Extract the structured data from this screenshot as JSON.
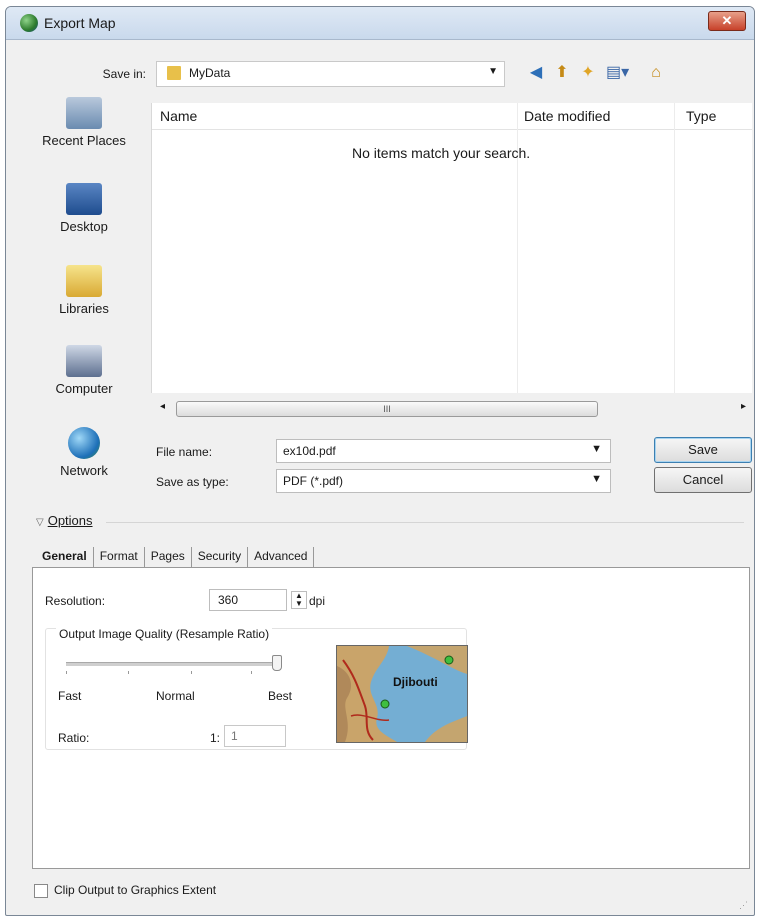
{
  "window": {
    "title": "Export Map",
    "close_label": "✕"
  },
  "toolbar": {
    "save_in_label": "Save in:",
    "save_in_value": "MyData",
    "icons": [
      "back-icon",
      "up-folder-icon",
      "new-folder-icon",
      "views-menu-icon",
      "home-icon"
    ]
  },
  "places": [
    {
      "label": "Recent Places",
      "icon": "recent-places-icon"
    },
    {
      "label": "Desktop",
      "icon": "desktop-icon"
    },
    {
      "label": "Libraries",
      "icon": "libraries-icon"
    },
    {
      "label": "Computer",
      "icon": "computer-icon"
    },
    {
      "label": "Network",
      "icon": "network-icon"
    }
  ],
  "file_list": {
    "columns": [
      "Name",
      "Date modified",
      "Type"
    ],
    "empty_message": "No items match your search.",
    "scroll_thumb": "III"
  },
  "file_name": {
    "label": "File name:",
    "value": "ex10d.pdf"
  },
  "save_as_type": {
    "label": "Save as type:",
    "value": "PDF (*.pdf)"
  },
  "buttons": {
    "save": "Save",
    "cancel": "Cancel"
  },
  "options": {
    "toggle_label": "Options",
    "tabs": [
      {
        "label": "General",
        "active": true
      },
      {
        "label": "Format",
        "active": false
      },
      {
        "label": "Pages",
        "active": false
      },
      {
        "label": "Security",
        "active": false
      },
      {
        "label": "Advanced",
        "active": false
      }
    ],
    "resolution": {
      "label": "Resolution:",
      "value": "360",
      "unit": "dpi"
    },
    "quality": {
      "title": "Output Image Quality (Resample Ratio)",
      "labels": {
        "fast": "Fast",
        "normal": "Normal",
        "best": "Best"
      },
      "slider_position": "Best",
      "ratio_label": "Ratio:",
      "ratio_fixed": "1:",
      "ratio_value": "1"
    },
    "preview_label": "Djibouti"
  },
  "clip_output": {
    "label": "Clip Output to Graphics Extent",
    "checked": false
  }
}
